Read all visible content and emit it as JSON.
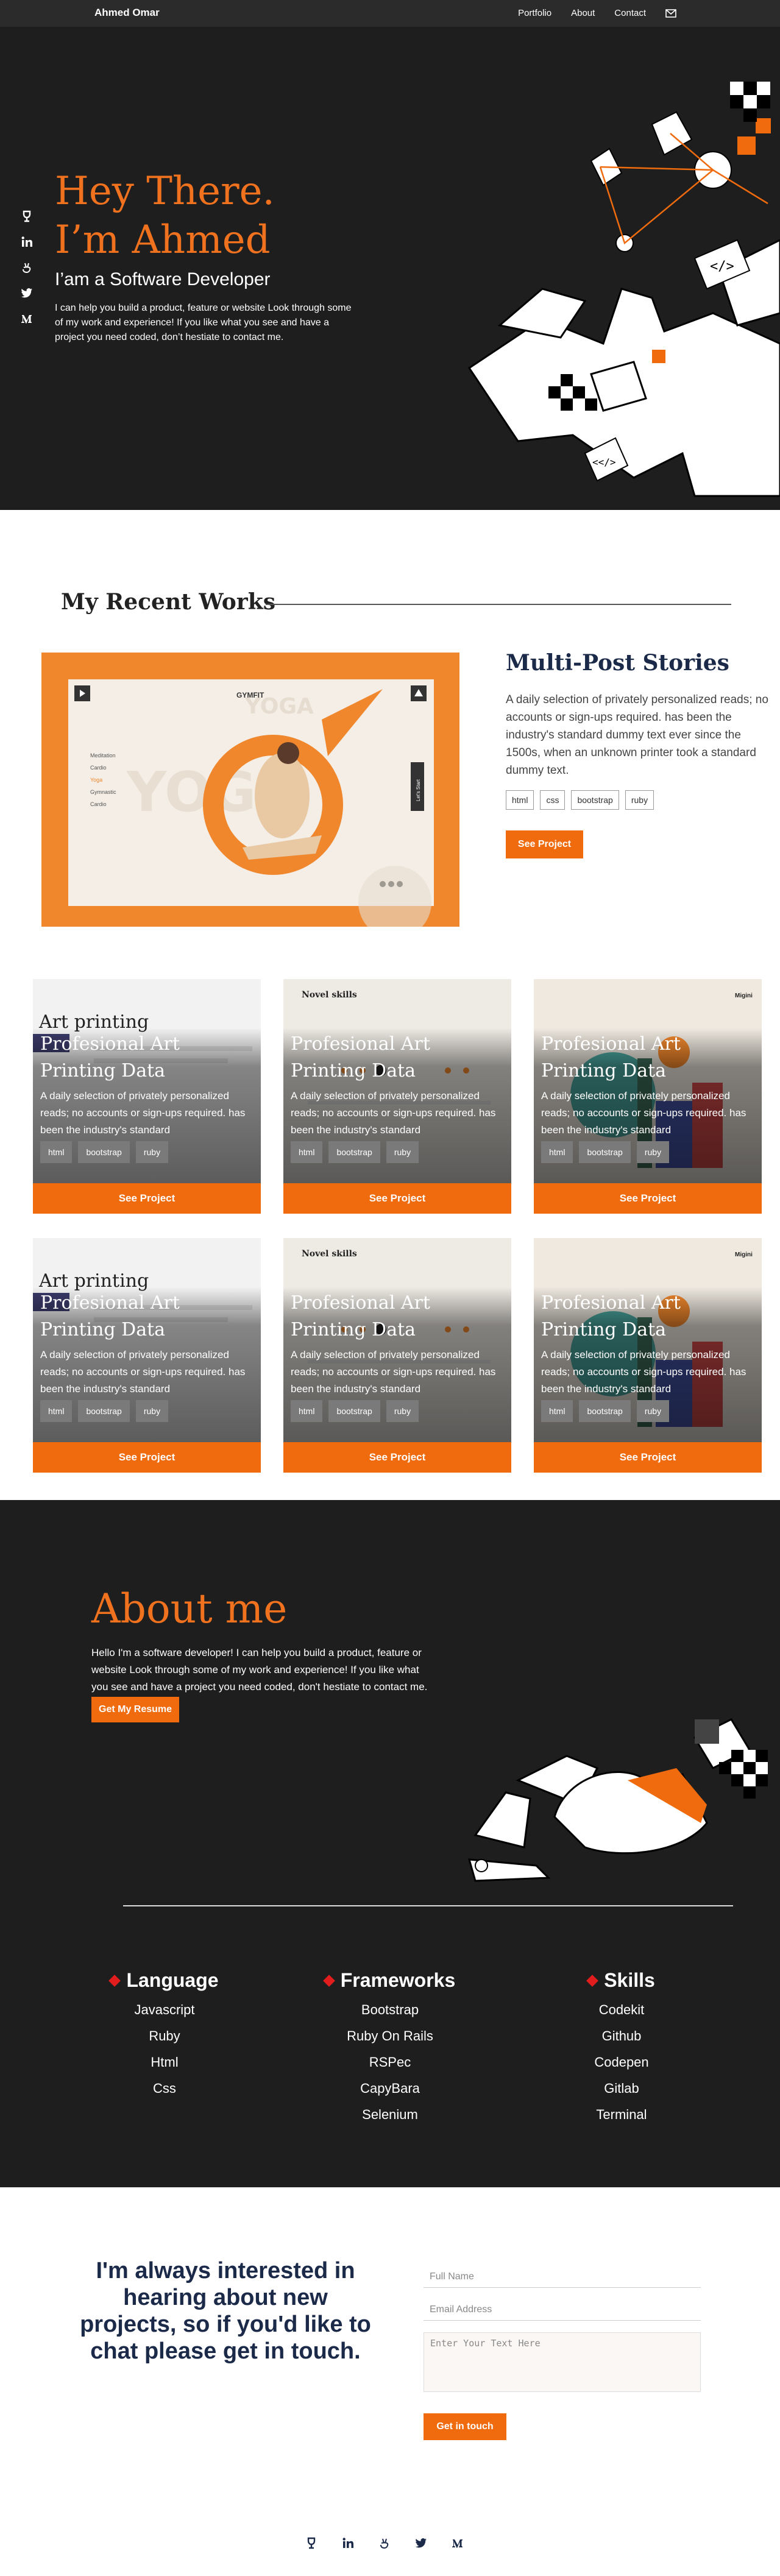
{
  "nav": {
    "brand": "Ahmed Omar",
    "links": [
      "Portfolio",
      "About",
      "Contact"
    ],
    "mail_icon": "envelope-icon"
  },
  "hero": {
    "greeting_line1": "Hey There.",
    "greeting_line2": "I’m Ahmed",
    "subtitle": "I’am a Software Developer",
    "description": "I can help you build a product, feature or website Look through some of my work and experience! If you like what you see and have a project you need coded, don’t hestiate to contact me.",
    "social_icons": [
      "angellist-icon",
      "linkedin-icon",
      "angellist-hand-icon",
      "twitter-icon",
      "medium-icon"
    ],
    "art_code_1": "</>",
    "art_code_2": "<</>"
  },
  "works": {
    "title": "My Recent Works",
    "featured": {
      "title": "Multi-Post Stories",
      "description": "A daily selection of privately personalized reads; no accounts or sign-ups required. has been the industry's standard dummy text ever since the 1500s, when an unknown printer took a standard dummy text.",
      "tags": [
        "html",
        "css",
        "bootstrap",
        "ruby"
      ],
      "button": "See Project",
      "mock": {
        "logo": "GYMFIT",
        "bg_text": "YOGA",
        "menu": [
          "Meditation",
          "Cardio",
          "Yoga",
          "Gymnastic",
          "Cardio"
        ],
        "side_label": "Let's Start"
      }
    },
    "cards": [
      {
        "title": "Profesional Art Printing Data",
        "description": "A daily selection of privately personalized reads; no accounts or sign-ups required. has been the industry's standard",
        "tags": [
          "html",
          "bootstrap",
          "ruby"
        ],
        "button": "See Project",
        "peek": "Art printing"
      },
      {
        "title": "Profesional Art Printing Data",
        "description": "A daily selection of privately personalized reads; no accounts or sign-ups required. has been the industry's standard",
        "tags": [
          "html",
          "bootstrap",
          "ruby"
        ],
        "button": "See Project",
        "peek": "Novel skills"
      },
      {
        "title": "Profesional Art Printing Data",
        "description": "A daily selection of privately personalized reads; no accounts or sign-ups required. has been the industry's standard",
        "tags": [
          "html",
          "bootstrap",
          "ruby"
        ],
        "button": "See Project",
        "peek": "Migini"
      },
      {
        "title": "Profesional Art Printing Data",
        "description": "A daily selection of privately personalized reads; no accounts or sign-ups required. has been the industry's standard",
        "tags": [
          "html",
          "bootstrap",
          "ruby"
        ],
        "button": "See Project",
        "peek": "Art printing"
      },
      {
        "title": "Profesional Art Printing Data",
        "description": "A daily selection of privately personalized reads; no accounts or sign-ups required. has been the industry's standard",
        "tags": [
          "html",
          "bootstrap",
          "ruby"
        ],
        "button": "See Project",
        "peek": "Novel skills"
      },
      {
        "title": "Profesional Art Printing Data",
        "description": "A daily selection of privately personalized reads; no accounts or sign-ups required. has been the industry's standard",
        "tags": [
          "html",
          "bootstrap",
          "ruby"
        ],
        "button": "See Project",
        "peek": "Migini"
      }
    ]
  },
  "about": {
    "title": "About me",
    "description": "Hello I'm a software developer! I can help you build a product, feature or website Look through some of my work and experience! If you like what you see and have a project you need coded, don't hestiate to contact me.",
    "button": "Get My Resume",
    "skills": [
      {
        "heading": "Language",
        "items": [
          "Javascript",
          "Ruby",
          "Html",
          "Css"
        ]
      },
      {
        "heading": "Frameworks",
        "items": [
          "Bootstrap",
          "Ruby On Rails",
          "RSPec",
          "CapyBara",
          "Selenium"
        ]
      },
      {
        "heading": "Skills",
        "items": [
          "Codekit",
          "Github",
          "Codepen",
          "Gitlab",
          "Terminal"
        ]
      }
    ]
  },
  "contact": {
    "heading": "I'm always interested in hearing about new projects, so if you'd like to chat please get in touch.",
    "name_placeholder": "Full Name",
    "email_placeholder": "Email Address",
    "message_placeholder": "Enter Your Text Here",
    "button": "Get in touch",
    "social_icons": [
      "angellist-icon",
      "linkedin-icon",
      "angellist-hand-icon",
      "twitter-icon",
      "medium-icon"
    ]
  },
  "colors": {
    "accent": "#f06a0e",
    "dark": "#1e1e1e",
    "navy": "#1c2a4a",
    "diamond": "#e21d1d"
  }
}
